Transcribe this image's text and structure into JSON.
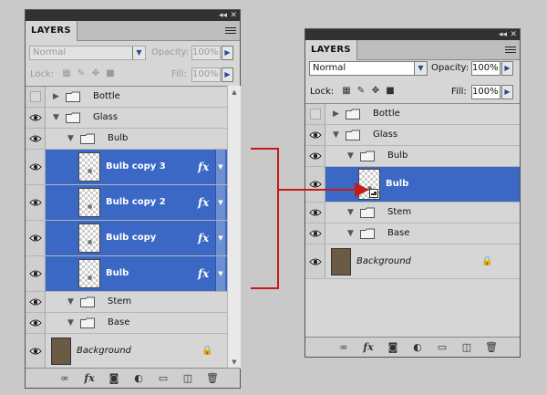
{
  "left_panel": {
    "tab": "LAYERS",
    "blend_mode": "Normal",
    "opacity_label": "Opacity:",
    "opacity": "100%",
    "lock_label": "Lock:",
    "fill_label": "Fill:",
    "fill": "100%",
    "layers": [
      {
        "name": "Bottle",
        "kind": "group",
        "expanded": false,
        "visible": false
      },
      {
        "name": "Glass",
        "kind": "group",
        "expanded": true,
        "visible": true
      },
      {
        "name": "Bulb",
        "kind": "group",
        "expanded": true,
        "visible": true
      },
      {
        "name": "Bulb copy 3",
        "kind": "layer",
        "selected": true,
        "visible": true,
        "fx": "fx"
      },
      {
        "name": "Bulb copy 2",
        "kind": "layer",
        "selected": true,
        "visible": true,
        "fx": "fx"
      },
      {
        "name": "Bulb copy",
        "kind": "layer",
        "selected": true,
        "visible": true,
        "fx": "fx"
      },
      {
        "name": "Bulb",
        "kind": "layer",
        "selected": true,
        "visible": true,
        "fx": "fx"
      },
      {
        "name": "Stem",
        "kind": "group",
        "expanded": true,
        "visible": true
      },
      {
        "name": "Base",
        "kind": "group",
        "expanded": true,
        "visible": true
      },
      {
        "name": "Background",
        "kind": "background",
        "visible": true
      }
    ]
  },
  "right_panel": {
    "tab": "LAYERS",
    "blend_mode": "Normal",
    "opacity_label": "Opacity:",
    "opacity": "100%",
    "lock_label": "Lock:",
    "fill_label": "Fill:",
    "fill": "100%",
    "layers": [
      {
        "name": "Bottle",
        "kind": "group",
        "expanded": false,
        "visible": false
      },
      {
        "name": "Glass",
        "kind": "group",
        "expanded": true,
        "visible": true
      },
      {
        "name": "Bulb",
        "kind": "group",
        "expanded": true,
        "visible": true
      },
      {
        "name": "Bulb",
        "kind": "smart-object",
        "selected": true,
        "visible": true
      },
      {
        "name": "Stem",
        "kind": "group",
        "expanded": true,
        "visible": true
      },
      {
        "name": "Base",
        "kind": "group",
        "expanded": true,
        "visible": true
      },
      {
        "name": "Background",
        "kind": "background",
        "visible": true
      }
    ]
  },
  "bottom_icons": [
    "link-icon",
    "fx-icon",
    "mask-icon",
    "adjustment-icon",
    "folder-icon",
    "new-layer-icon",
    "trash-icon"
  ],
  "bottom_fx_label": "fx",
  "colors": {
    "selection": "#3a68c4",
    "connector": "#c41a1a",
    "panel": "#d6d6d6"
  }
}
